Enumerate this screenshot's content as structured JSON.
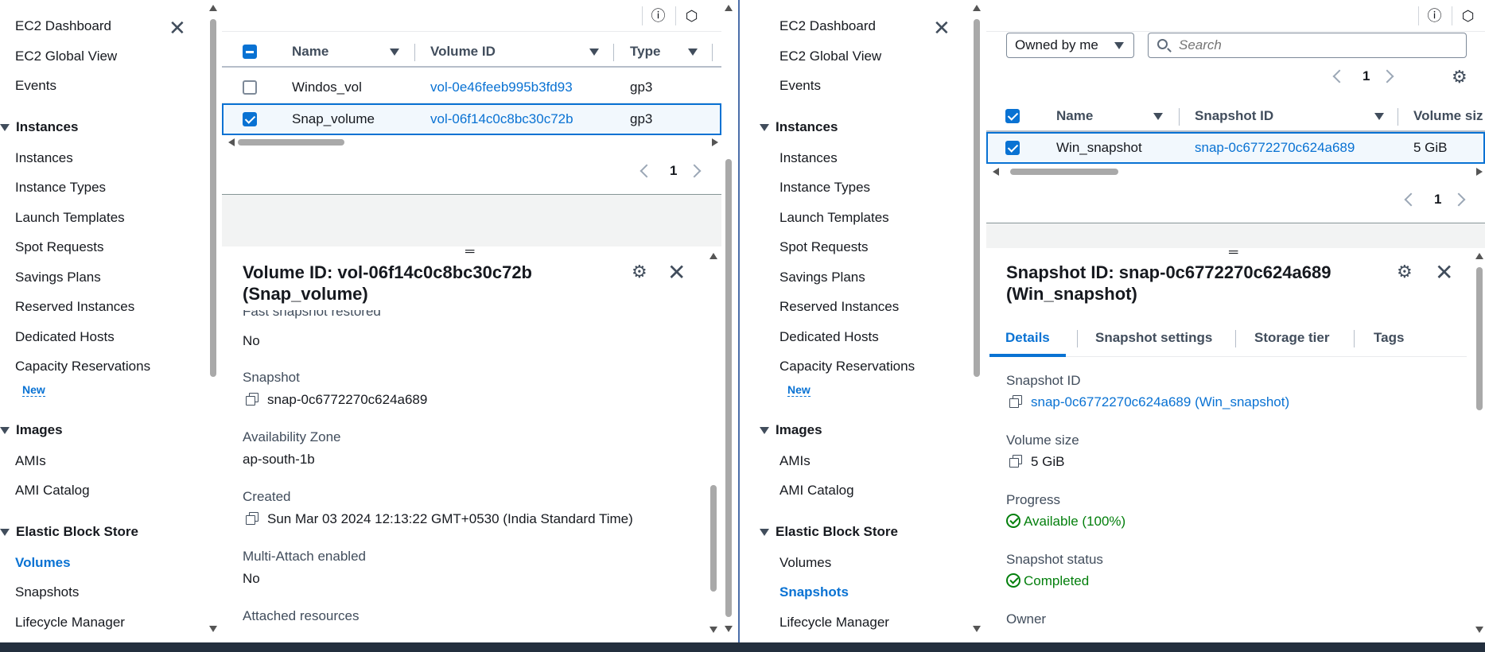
{
  "sidebar": {
    "top_items": [
      "EC2 Dashboard",
      "EC2 Global View",
      "Events"
    ],
    "instances_section": "Instances",
    "instances_items": [
      "Instances",
      "Instance Types",
      "Launch Templates",
      "Spot Requests",
      "Savings Plans",
      "Reserved Instances",
      "Dedicated Hosts",
      "Capacity Reservations"
    ],
    "new_badge": "New",
    "images_section": "Images",
    "images_items": [
      "AMIs",
      "AMI Catalog"
    ],
    "ebs_section": "Elastic Block Store",
    "ebs_items": [
      "Volumes",
      "Snapshots",
      "Lifecycle Manager"
    ]
  },
  "left": {
    "active_nav": "Volumes",
    "table": {
      "columns": [
        "Name",
        "Volume ID",
        "Type"
      ],
      "rows": [
        {
          "name": "Windos_vol",
          "volume_id": "vol-0e46feeb995b3fd93",
          "type": "gp3",
          "selected": false
        },
        {
          "name": "Snap_volume",
          "volume_id": "vol-06f14c0c8bc30c72b",
          "type": "gp3",
          "selected": true
        }
      ],
      "page": "1"
    },
    "detail": {
      "title_line1": "Volume ID: vol-06f14c0c8bc30c72b",
      "title_line2": "(Snap_volume)",
      "cut_label": "Fast snapshot restored",
      "fields": [
        {
          "label": "",
          "value": "No"
        },
        {
          "label": "Snapshot",
          "value": "snap-0c6772270c624a689"
        },
        {
          "label": "Availability Zone",
          "value": "ap-south-1b"
        },
        {
          "label": "Created",
          "value": "Sun Mar 03 2024 12:13:22 GMT+0530 (India Standard Time)"
        },
        {
          "label": "Multi-Attach enabled",
          "value": "No"
        },
        {
          "label": "Attached resources",
          "value": ""
        }
      ]
    }
  },
  "right": {
    "active_nav": "Snapshots",
    "filter_select": "Owned by me",
    "search_placeholder": "Search",
    "page": "1",
    "table": {
      "columns": [
        "Name",
        "Snapshot ID",
        "Volume siz"
      ],
      "rows": [
        {
          "name": "Win_snapshot",
          "snapshot_id": "snap-0c6772270c624a689",
          "volume_size": "5 GiB",
          "selected": true
        }
      ]
    },
    "detail": {
      "title_line1": "Snapshot ID: snap-0c6772270c624a689",
      "title_line2": "(Win_snapshot)",
      "tabs": [
        "Details",
        "Snapshot settings",
        "Storage tier",
        "Tags"
      ],
      "fields": {
        "snapshot_id_label": "Snapshot ID",
        "snapshot_id_value": "snap-0c6772270c624a689 (Win_snapshot)",
        "volume_size_label": "Volume size",
        "volume_size_value": "5 GiB",
        "progress_label": "Progress",
        "progress_value": "Available (100%)",
        "status_label": "Snapshot status",
        "status_value": "Completed",
        "owner_label": "Owner"
      }
    }
  },
  "colors": {
    "link": "#0972d3",
    "success": "#037f0c",
    "text": "#16191f",
    "muted": "#414d5c",
    "footer": "#232f3e"
  }
}
